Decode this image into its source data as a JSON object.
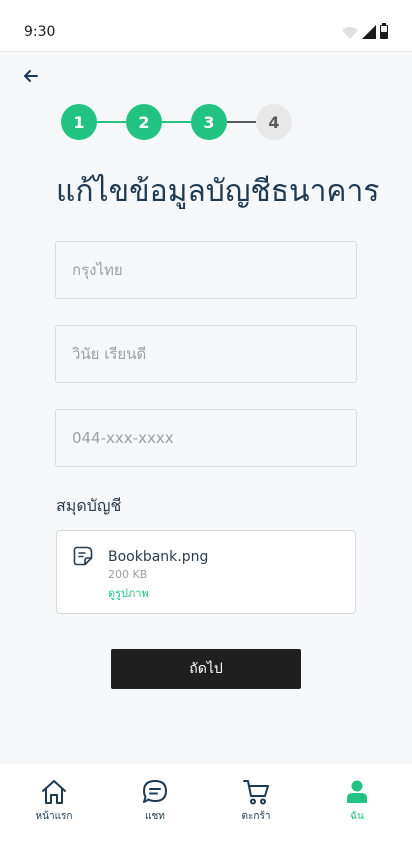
{
  "status_bar": {
    "time": "9:30"
  },
  "stepper": {
    "steps": [
      {
        "label": "1",
        "done": true
      },
      {
        "label": "2",
        "done": true
      },
      {
        "label": "3",
        "done": true
      },
      {
        "label": "4",
        "done": false
      }
    ]
  },
  "page": {
    "title": "แก้ไขข้อมูลบัญชีธนาคาร"
  },
  "form": {
    "bank_placeholder": "กรุงไทย",
    "name_placeholder": "วินัย เรียนดี",
    "account_placeholder": "044-xxx-xxxx",
    "passbook_label": "สมุดบัญชี"
  },
  "file": {
    "name": "Bookbank.png",
    "size": "200 KB",
    "view_link": "ดูรูปภาพ"
  },
  "actions": {
    "next_label": "ถัดไป"
  },
  "colors": {
    "accent": "#22c283",
    "primary_text": "#1e3a52",
    "button_dark": "#1f1f1f"
  },
  "bottom_nav": {
    "items": [
      {
        "label": "หน้าแรก",
        "icon": "home-icon",
        "active": false
      },
      {
        "label": "แชท",
        "icon": "chat-icon",
        "active": false
      },
      {
        "label": "ตะกร้า",
        "icon": "cart-icon",
        "active": false
      },
      {
        "label": "ฉัน",
        "icon": "profile-icon",
        "active": true
      }
    ]
  }
}
